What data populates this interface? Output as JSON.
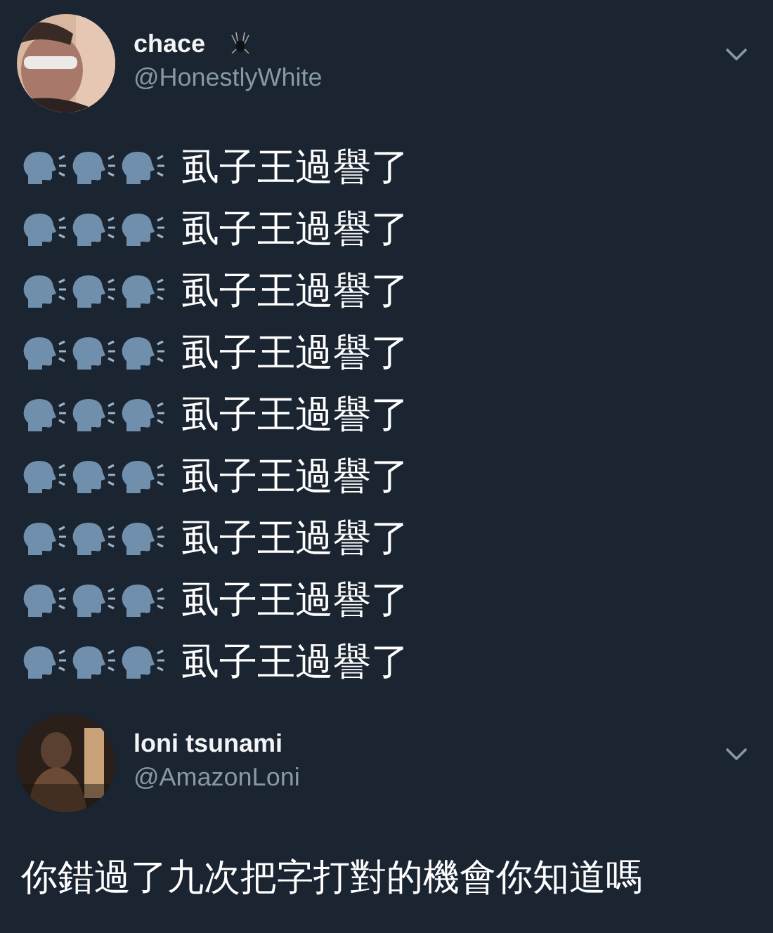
{
  "tweets": [
    {
      "author": {
        "name": "chace",
        "handle": "@HonestlyWhite"
      },
      "lines": [
        {
          "text": "虱子王過譽了"
        },
        {
          "text": "虱子王過譽了"
        },
        {
          "text": "虱子王過譽了"
        },
        {
          "text": "虱子王過譽了"
        },
        {
          "text": "虱子王過譽了"
        },
        {
          "text": "虱子王過譽了"
        },
        {
          "text": "虱子王過譽了"
        },
        {
          "text": "虱子王過譽了"
        },
        {
          "text": "虱子王過譽了"
        }
      ]
    },
    {
      "author": {
        "name": "loni tsunami",
        "handle": "@AmazonLoni"
      },
      "text": "你錯過了九次把字打對的機會你知道嗎"
    }
  ]
}
